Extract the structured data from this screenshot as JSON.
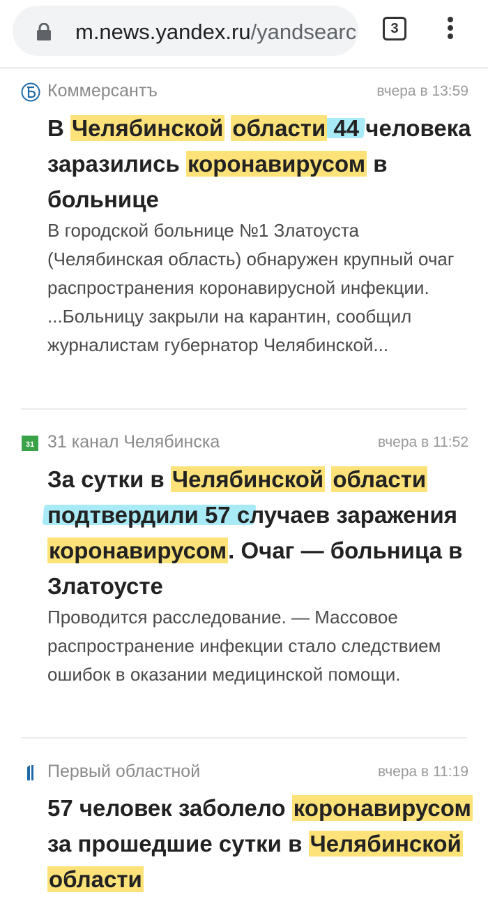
{
  "browser": {
    "url_main": "m.news.yandex.ru",
    "url_rest": "/yandsearc",
    "tab_count": "3"
  },
  "articles": [
    {
      "source": "Коммерсантъ",
      "time": "вчера в 13:59",
      "headline": [
        {
          "t": "В ",
          "h": false
        },
        {
          "t": "Челябинской",
          "h": true
        },
        {
          "t": " ",
          "h": false
        },
        {
          "t": "области",
          "h": true
        },
        {
          "t": " 44",
          "h": false,
          "m": true
        },
        {
          "t": " человека заразились ",
          "h": false
        },
        {
          "t": "коронавирусом",
          "h": true
        },
        {
          "t": " в больнице",
          "h": false
        }
      ],
      "snippet": "В городской больнице №1 Златоуста (Челябинская область) обнаружен крупный очаг распространения коронавирусной инфекции. ...Больницу закрыли на карантин, сообщил журналистам губернатор Челябинской..."
    },
    {
      "source": "31 канал Челябинска",
      "time": "вчера в 11:52",
      "headline": [
        {
          "t": "За сутки в ",
          "h": false
        },
        {
          "t": "Челябинской",
          "h": true
        },
        {
          "t": " ",
          "h": false
        },
        {
          "t": "области",
          "h": true
        },
        {
          "t": " ",
          "h": false
        },
        {
          "t": "подтвердили 57 с",
          "h": false,
          "m": true
        },
        {
          "t": "лучаев заражения ",
          "h": false
        },
        {
          "t": "коронавирусом",
          "h": true
        },
        {
          "t": ". Очаг — больница в Златоусте",
          "h": false
        }
      ],
      "snippet": "Проводится расследование. — Массовое распространение инфекции стало следствием ошибок в оказании медицинской помощи."
    },
    {
      "source": "Первый областной",
      "time": "вчера в 11:19",
      "headline": [
        {
          "t": "57 человек заболело ",
          "h": false
        },
        {
          "t": "коронавирусом",
          "h": true
        },
        {
          "t": " за прошедшие сутки в ",
          "h": false
        },
        {
          "t": "Челябинской",
          "h": true
        },
        {
          "t": " ",
          "h": false
        },
        {
          "t": "области",
          "h": true
        }
      ],
      "snippet": ""
    }
  ]
}
